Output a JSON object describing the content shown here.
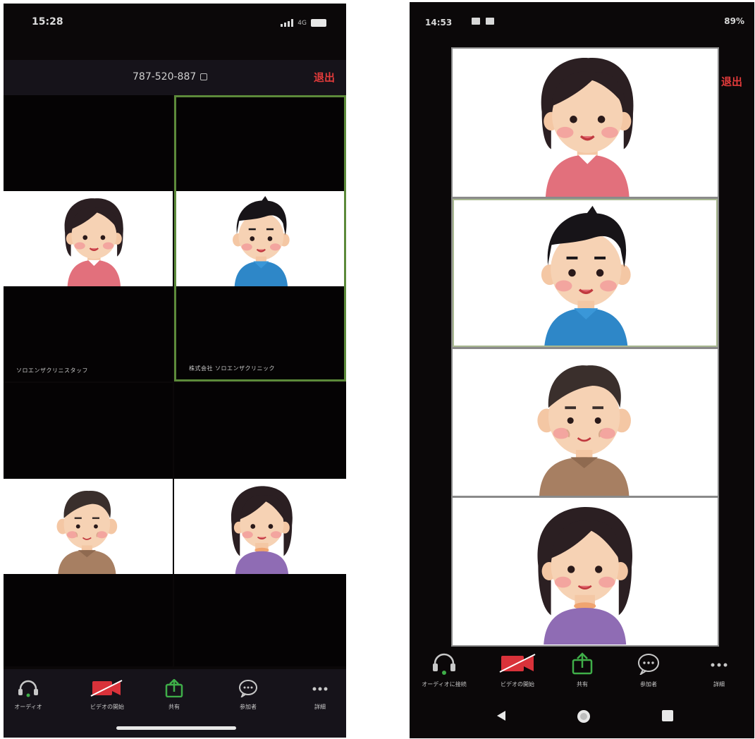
{
  "iphone": {
    "status_time": "15:28",
    "network_label": "4G",
    "meeting_id": "787-520-887",
    "leave_label": "退出",
    "participants": [
      {
        "name": "ソロエンザクリニスタッフ"
      },
      {
        "name": "株式会社 ソロエンザクリニック"
      },
      {
        "name": ""
      },
      {
        "name": ""
      }
    ],
    "toolbar": [
      {
        "label": "オーディオ",
        "icon": "headphones-icon"
      },
      {
        "label": "ビデオの開始",
        "icon": "video-off-icon"
      },
      {
        "label": "共有",
        "icon": "share-icon"
      },
      {
        "label": "参加者",
        "icon": "chat-icon"
      },
      {
        "label": "詳細",
        "icon": "more-icon"
      }
    ]
  },
  "android": {
    "status_time": "14:53",
    "status_right": "89%",
    "leave_label": "退出",
    "toolbar": [
      {
        "label": "オーディオに接続",
        "icon": "headphones-icon"
      },
      {
        "label": "ビデオの開始",
        "icon": "video-off-icon"
      },
      {
        "label": "共有",
        "icon": "share-icon"
      },
      {
        "label": "参加者",
        "icon": "chat-icon"
      },
      {
        "label": "詳細",
        "icon": "more-icon"
      }
    ],
    "nav": [
      "back-icon",
      "home-icon",
      "recents-icon"
    ]
  },
  "colors": {
    "leave": "#e23b3b",
    "active_speaker_border": "#5c8a3a",
    "share_green": "#3fae49",
    "video_off_red": "#d9323a"
  }
}
